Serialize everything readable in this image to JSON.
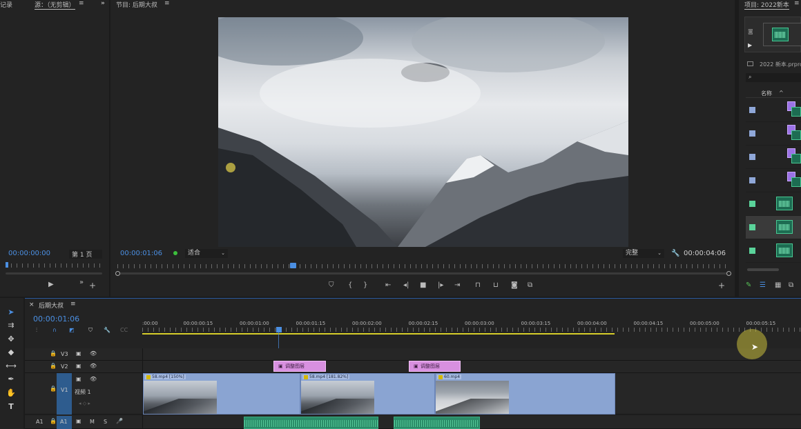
{
  "source_panel": {
    "tab_left": "记录",
    "tab_source": "源：（无剪辑）",
    "menu": "≡",
    "overflow": "»",
    "timecode": "00:00:00:00",
    "page": "第 1 页"
  },
  "program_monitor": {
    "title": "节目: 后期大叔",
    "menu": "≡",
    "timecode": "00:00:01:06",
    "fit": "适合",
    "quality": "完整",
    "duration": "00:00:04:06"
  },
  "project_panel": {
    "title": "项目: 2022新本",
    "menu": "≡",
    "filename": "2022 新本.prproj",
    "column_name": "名称"
  },
  "timeline": {
    "close": "×",
    "title": "后期大叔",
    "menu": "≡",
    "timecode": "00:00:01:06",
    "ruler_labels": [
      ":00:00",
      "00:00:00:15",
      "00:00:01:00",
      "00:00:01:15",
      "00:00:02:00",
      "00:00:02:15",
      "00:00:03:00",
      "00:00:03:15",
      "00:00:04:00",
      "00:00:04:15",
      "00:00:05:00",
      "00:00:05:15"
    ],
    "tracks": {
      "v3": "V3",
      "v2": "V2",
      "v1_src": "V1",
      "v1_name": "视频 1",
      "a1_src": "A1",
      "a1": "A1",
      "m": "M",
      "s": "S"
    },
    "adjust_layer_1": "调整图层",
    "adjust_layer_2": "调整图层",
    "clips": [
      {
        "label": "58.mp4 [150%]"
      },
      {
        "label": "58.mp4 [181.82%]"
      },
      {
        "label": "60.mp4"
      }
    ]
  },
  "colors": {
    "accent": "#4b8fe2",
    "clip_blue": "#8aa4d2",
    "adjust_pink": "#d890e0",
    "audio_green": "#2a8c68",
    "work_area": "#d8cf2a"
  },
  "icons": [
    "play-icon",
    "plus-icon",
    "marker-icon",
    "in-point-icon",
    "out-point-icon",
    "go-to-in-icon",
    "step-back-icon",
    "stop-icon",
    "step-forward-icon",
    "go-to-out-icon",
    "lift-icon",
    "extract-icon",
    "camera-icon",
    "compare-icon",
    "wrench-icon",
    "selection-tool-icon",
    "track-select-icon",
    "ripple-tool-icon",
    "razor-icon",
    "slip-icon",
    "pen-icon",
    "hand-icon",
    "type-icon",
    "lock-icon",
    "eye-icon",
    "film-icon",
    "mic-icon",
    "search-icon"
  ]
}
